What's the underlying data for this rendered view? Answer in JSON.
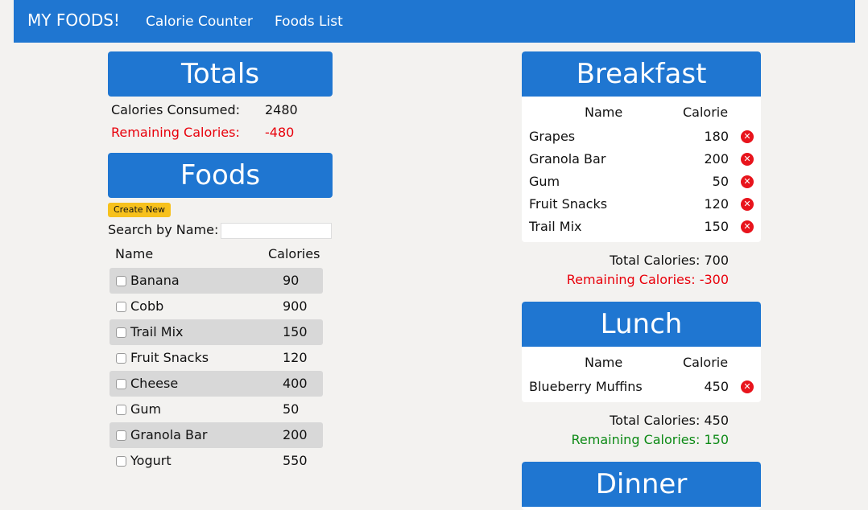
{
  "nav": {
    "brand": "MY FOODS!",
    "links": [
      "Calorie Counter",
      "Foods List"
    ]
  },
  "totals": {
    "title": "Totals",
    "consumed_label": "Calories Consumed:",
    "consumed_value": "2480",
    "remaining_label": "Remaining Calories:",
    "remaining_value": "-480"
  },
  "foods": {
    "title": "Foods",
    "create_label": "Create New",
    "search_label": "Search by Name:",
    "search_value": "",
    "col_name": "Name",
    "col_calories": "Calories",
    "items": [
      {
        "name": "Banana",
        "calories": "90"
      },
      {
        "name": "Cobb",
        "calories": "900"
      },
      {
        "name": "Trail Mix",
        "calories": "150"
      },
      {
        "name": "Fruit Snacks",
        "calories": "120"
      },
      {
        "name": "Cheese",
        "calories": "400"
      },
      {
        "name": "Gum",
        "calories": "50"
      },
      {
        "name": "Granola Bar",
        "calories": "200"
      },
      {
        "name": "Yogurt",
        "calories": "550"
      }
    ]
  },
  "breakfast": {
    "title": "Breakfast",
    "col_name": "Name",
    "col_calorie": "Calorie",
    "items": [
      {
        "name": "Grapes",
        "calories": "180"
      },
      {
        "name": "Granola Bar",
        "calories": "200"
      },
      {
        "name": "Gum",
        "calories": "50"
      },
      {
        "name": "Fruit Snacks",
        "calories": "120"
      },
      {
        "name": "Trail Mix",
        "calories": "150"
      }
    ],
    "total_text": "Total Calories: 700",
    "remaining_text": "Remaining Calories: -300"
  },
  "lunch": {
    "title": "Lunch",
    "col_name": "Name",
    "col_calorie": "Calorie",
    "items": [
      {
        "name": "Blueberry Muffins",
        "calories": "450"
      }
    ],
    "total_text": "Total Calories: 450",
    "remaining_text": "Remaining Calories: 150"
  },
  "dinner": {
    "title": "Dinner"
  },
  "colors": {
    "primary": "#1f76d1",
    "create_button": "#f7c11c",
    "negative": "#e8000b",
    "positive": "#0d8a16"
  },
  "icons": {
    "delete": "delete-circle-icon",
    "checkbox": "checkbox-icon"
  }
}
